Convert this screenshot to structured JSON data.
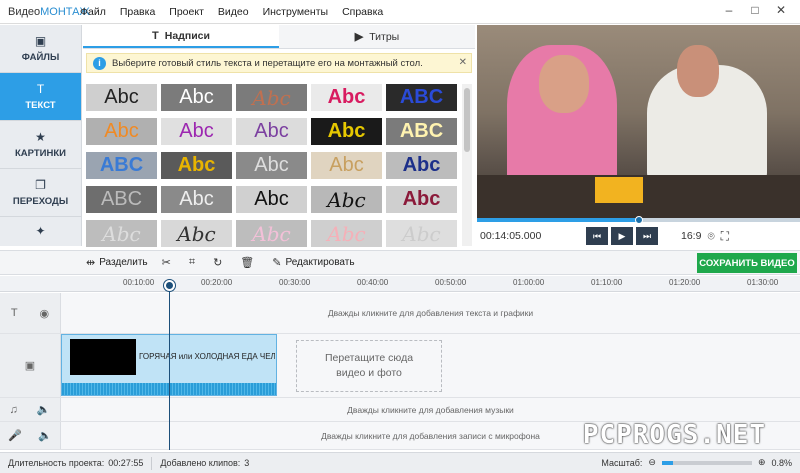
{
  "app": {
    "name_part1": "Видео",
    "name_part2": "МОНТАЖ"
  },
  "menu": [
    "Файл",
    "Правка",
    "Проект",
    "Видео",
    "Инструменты",
    "Справка"
  ],
  "window_controls": [
    "–",
    "□",
    "✕"
  ],
  "sidebar": {
    "items": [
      {
        "label": "ФАЙЛЫ",
        "icon": "image-icon",
        "glyph": "▣",
        "active": false
      },
      {
        "label": "ТЕКСТ",
        "icon": "text-icon",
        "glyph": "T",
        "active": true
      },
      {
        "label": "КАРТИНКИ",
        "icon": "star-icon",
        "glyph": "★",
        "active": false
      },
      {
        "label": "ПЕРЕХОДЫ",
        "icon": "transitions-icon",
        "glyph": "❐",
        "active": false
      },
      {
        "label": "",
        "icon": "effects-wand-icon",
        "glyph": "✦",
        "active": false
      }
    ]
  },
  "tabs": [
    {
      "label": "Надписи",
      "glyph": "T",
      "active": true
    },
    {
      "label": "Титры",
      "glyph": "▶",
      "active": false
    }
  ],
  "info_bar": {
    "text": "Выберите готовый стиль текста и перетащите его на монтажный стол.",
    "icon_glyph": "i",
    "close_glyph": "✕"
  },
  "text_styles": {
    "sample": "Abc",
    "sample_caps": "ABC"
  },
  "player": {
    "timecode": "00:14:05.000",
    "ratio": "16:9",
    "buttons": {
      "prev": "⏮",
      "play": "▶",
      "next": "⏭"
    },
    "progress": 0.5,
    "icons": {
      "camera": "⌾",
      "fullscreen": "⛶"
    }
  },
  "toolbar": {
    "split": "Разделить",
    "edit": "Редактировать",
    "save": "СОХРАНИТЬ ВИДЕО"
  },
  "ruler": [
    "00:10:00",
    "00:20:00",
    "00:30:00",
    "00:40:00",
    "00:50:00",
    "01:00:00",
    "01:10:00",
    "01:20:00",
    "01:30:00"
  ],
  "tracks": {
    "text_hint": "Дважды кликните для добавления текста и графики",
    "clip_title": "ГОРЯЧАЯ или ХОЛОДНАЯ ЕДА ЧЕЛЛЕНДЖ",
    "drop_line1": "Перетащите сюда",
    "drop_line2": "видео и фото",
    "music_hint": "Дважды кликните для добавления музыки",
    "mic_hint": "Дважды кликните для добавления записи с микрофона"
  },
  "status": {
    "duration_label": "Длительность проекта:",
    "duration_value": "00:27:55",
    "clips_label": "Добавлено клипов:",
    "clips_value": "3",
    "zoom_label": "Масштаб:",
    "zoom_value": "0.8%",
    "zoom_level": 0.12
  },
  "watermark": "PCPROGS.NET",
  "colors": {
    "accent": "#2d9ee6",
    "save": "#1fa84c",
    "sidebar_bg": "#e9ecf0"
  }
}
